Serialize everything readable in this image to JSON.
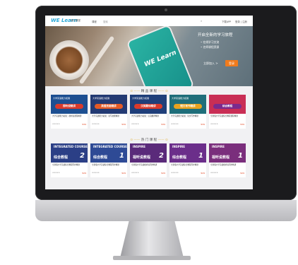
{
  "nav": {
    "logo": "WE Learn",
    "logo_sub": "随行课堂",
    "links": [
      "课程",
      "搜索"
    ],
    "search_placeholder": "",
    "right_links": [
      "下载APP",
      "登录 | 注册"
    ]
  },
  "hero": {
    "phone_logo": "WE Learn",
    "title": "开启全新的学习旅程",
    "lines": [
      "• 在线学习交流",
      "• 名师课程资源"
    ],
    "btn_join": "立即加入 >",
    "btn_login": "登录"
  },
  "sections": {
    "featured_title": "精 品 课 程",
    "hot_title": "热 门 课 程"
  },
  "featured": [
    {
      "top": "大学英语能力拓展",
      "pill": "视听说精讲",
      "title": "大学英语能力拓展：视听说课程精讲",
      "price": "¥39",
      "bg": "#1d4f91",
      "pill_color": "#d93a2b"
    },
    {
      "top": "大学英语能力拓展",
      "pill": "英语技能精讲",
      "title": "大学英语能力拓展：读写技能精讲",
      "price": "¥39",
      "bg": "#233a73",
      "pill_color": "#e45a26"
    },
    {
      "top": "大学英语能力拓展",
      "pill": "汉英翻译精讲",
      "title": "大学英语能力拓展：汉英翻译精讲",
      "price": "¥39",
      "bg": "#1f3f7a",
      "pill_color": "#d93a2b"
    },
    {
      "top": "大学英语能力拓展",
      "pill": "短文写作精讲",
      "title": "大学英语能力拓展：短文写作精讲",
      "price": "¥39",
      "bg": "#1f6e7a",
      "pill_color": "#e8a21f"
    },
    {
      "top": "",
      "pill": "综合教程",
      "title": "全新版大学英语综合教程课程精讲",
      "price": "¥39",
      "bg": "#c92e55",
      "pill_color": "#7a2a8e"
    }
  ],
  "hot": [
    {
      "big": "INTEGRATED COURSE",
      "name": "综合教程",
      "num": "2",
      "title": "全新版大学英语综合教程同步精讲",
      "price": "¥29",
      "bg": "#2b3f86"
    },
    {
      "big": "INTEGRATED COURSE",
      "name": "综合教程",
      "num": "1",
      "title": "全新版大学英语综合教程同步精讲",
      "price": "¥29",
      "bg": "#2e4a95"
    },
    {
      "big": "INSPIRE",
      "name": "视听说教程",
      "num": "2",
      "title": "全新版大学英语视听说同步精讲",
      "price": "¥29",
      "bg": "#5a2a7a"
    },
    {
      "big": "INSPIRE",
      "name": "综合教程",
      "num": "1",
      "title": "全新版大学英语综合教程同步精讲",
      "price": "¥29",
      "bg": "#6b2e8a"
    },
    {
      "big": "INSPIRE",
      "name": "视听说教程",
      "num": "1",
      "title": "全新版大学英语视听说同步精讲",
      "price": "¥29",
      "bg": "#7a2e7c"
    }
  ],
  "colors": {
    "accent": "#2aa9d8",
    "cta": "#f07b1d",
    "price": "#e1401b"
  }
}
